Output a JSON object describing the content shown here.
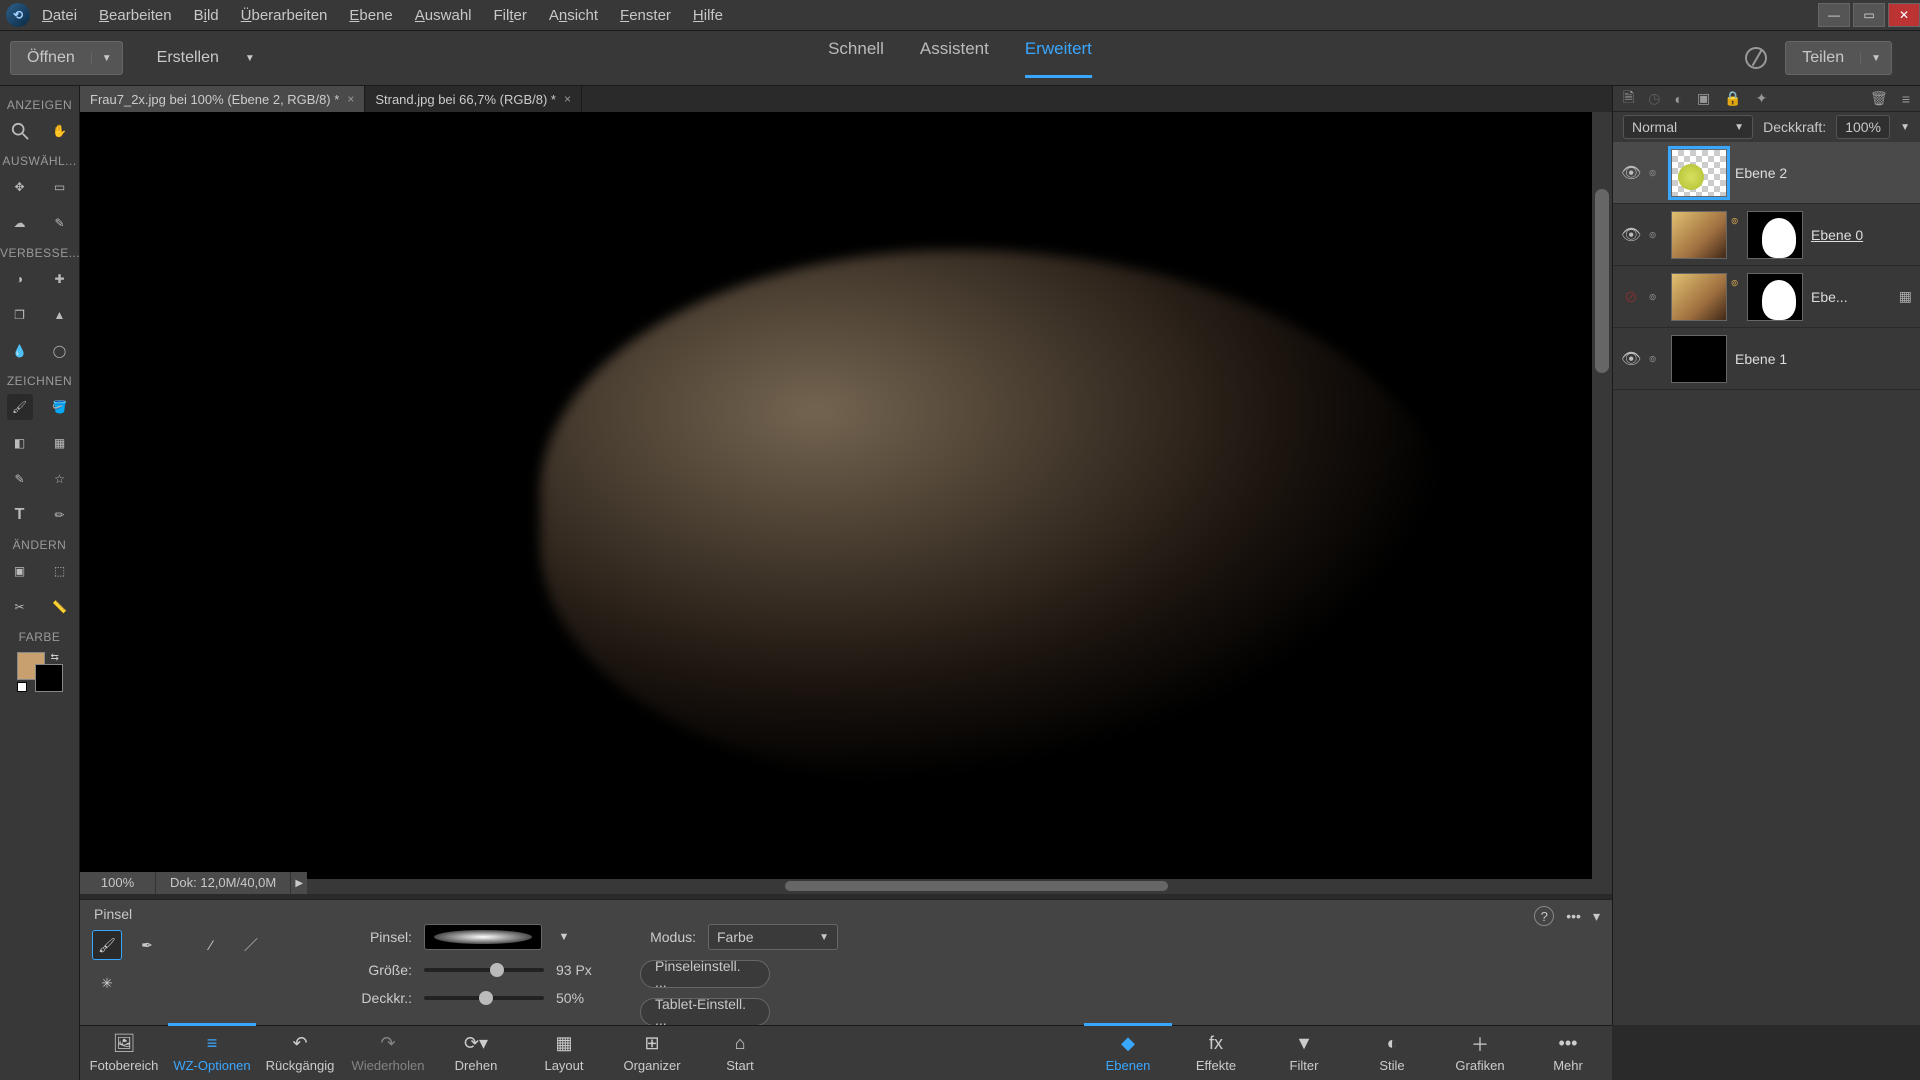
{
  "menu": {
    "datei": "Datei",
    "bearbeiten": "Bearbeiten",
    "bild": "Bild",
    "ueberarbeiten": "Überarbeiten",
    "ebene": "Ebene",
    "auswahl": "Auswahl",
    "filter": "Filter",
    "ansicht": "Ansicht",
    "fenster": "Fenster",
    "hilfe": "Hilfe"
  },
  "toolbar": {
    "open": "Öffnen",
    "create": "Erstellen",
    "share": "Teilen"
  },
  "workspace": {
    "quick": "Schnell",
    "guided": "Assistent",
    "expert": "Erweitert"
  },
  "tabs": [
    {
      "label": "Frau7_2x.jpg bei 100% (Ebene 2, RGB/8) *"
    },
    {
      "label": "Strand.jpg bei 66,7% (RGB/8) *"
    }
  ],
  "toolGroups": {
    "view": "ANZEIGEN",
    "select": "AUSWÄHL...",
    "enhance": "VERBESSE...",
    "draw": "ZEICHNEN",
    "modify": "ÄNDERN",
    "color": "FARBE"
  },
  "status": {
    "zoom": "100%",
    "doc": "Dok: 12,0M/40,0M"
  },
  "options": {
    "title": "Pinsel",
    "brushLabel": "Pinsel:",
    "sizeLabel": "Größe:",
    "sizeValue": "93 Px",
    "opacityLabel": "Deckkr.:",
    "opacityValue": "50%",
    "modeLabel": "Modus:",
    "modeValue": "Farbe",
    "brushSettings": "Pinseleinstell. ...",
    "tabletSettings": "Tablet-Einstell. ..."
  },
  "bottomBar": {
    "fotobereich": "Fotobereich",
    "wz": "WZ-Optionen",
    "undo": "Rückgängig",
    "redo": "Wiederholen",
    "rotate": "Drehen",
    "layout": "Layout",
    "organizer": "Organizer",
    "home": "Start",
    "ebenen": "Ebenen",
    "effekte": "Effekte",
    "filter": "Filter",
    "stile": "Stile",
    "grafiken": "Grafiken",
    "mehr": "Mehr"
  },
  "layersPanel": {
    "blendMode": "Normal",
    "opacityLabel": "Deckkraft:",
    "opacityValue": "100%",
    "layers": [
      {
        "name": "Ebene 2"
      },
      {
        "name": "Ebene 0"
      },
      {
        "name": "Ebe..."
      },
      {
        "name": "Ebene 1"
      }
    ]
  }
}
